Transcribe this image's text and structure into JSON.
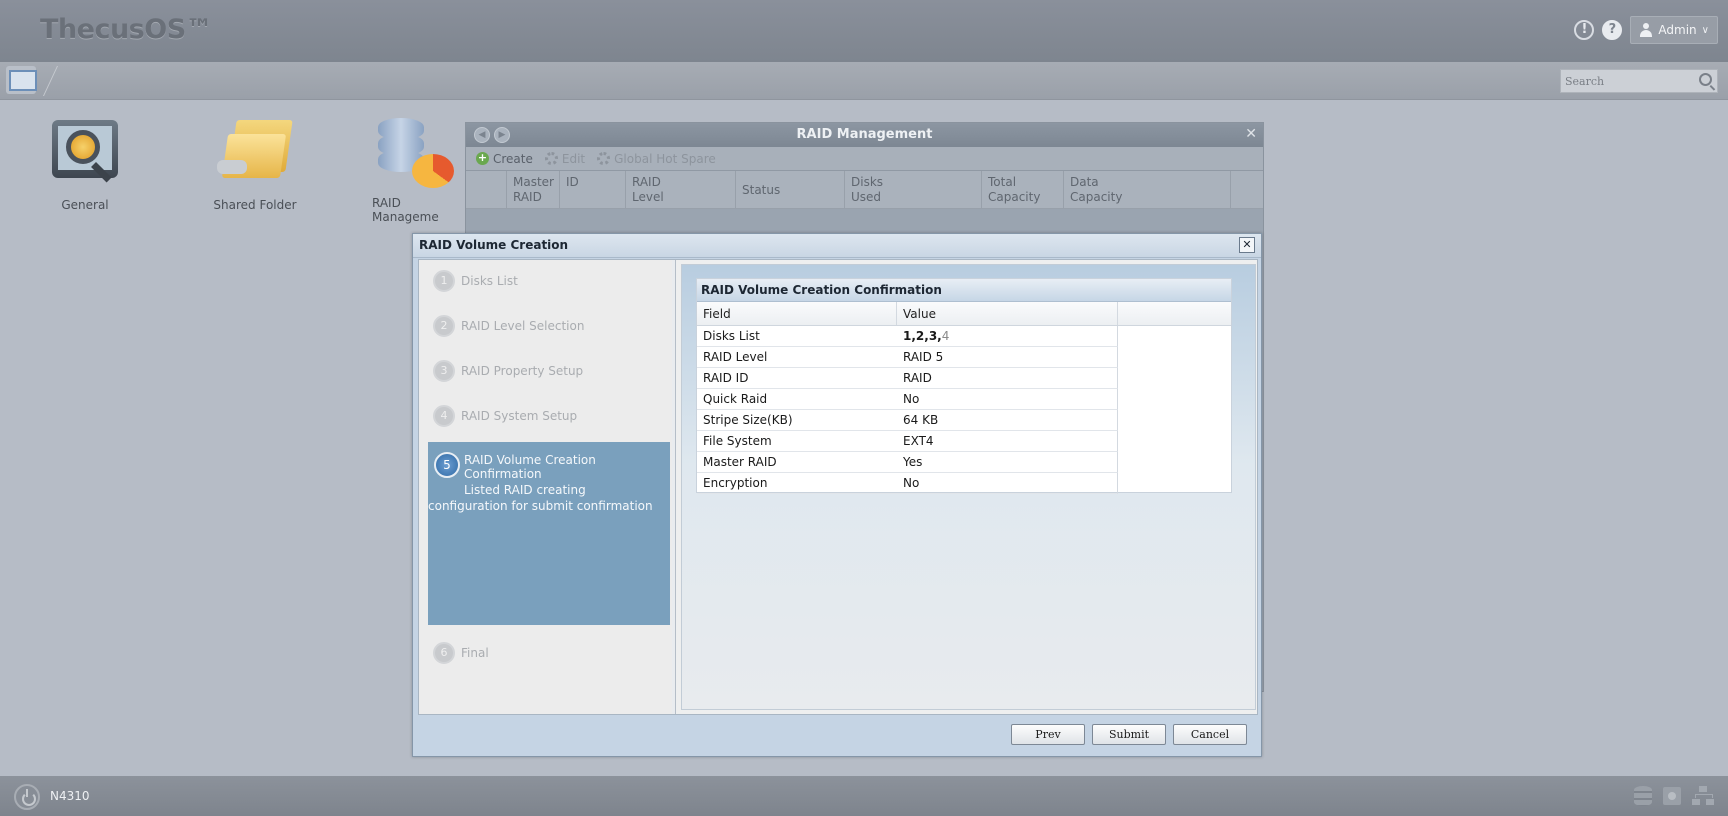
{
  "app": {
    "brand": "ThecusOS™"
  },
  "header": {
    "user_label": "Admin",
    "alert_icon": "!",
    "help_icon": "?"
  },
  "toolbar": {
    "search_placeholder": "Search"
  },
  "desktop": {
    "items": [
      {
        "label": "General",
        "icon": "general-settings-icon"
      },
      {
        "label": "Shared Folder",
        "icon": "shared-folder-icon"
      },
      {
        "label": "RAID Manageme",
        "icon": "raid-management-icon"
      }
    ]
  },
  "raid_window": {
    "title": "RAID Management",
    "tools": {
      "create": "Create",
      "edit": "Edit",
      "global_hot_spare": "Global Hot Spare"
    },
    "columns": [
      [
        "Master",
        "RAID"
      ],
      [
        "ID",
        ""
      ],
      [
        "RAID",
        "Level"
      ],
      [
        "Status",
        ""
      ],
      [
        "Disks",
        "Used"
      ],
      [
        "Total",
        "Capacity"
      ],
      [
        "Data",
        "Capacity"
      ]
    ]
  },
  "dialog": {
    "title": "RAID Volume Creation",
    "steps": [
      {
        "num": "1",
        "label": "Disks List"
      },
      {
        "num": "2",
        "label": "RAID Level Selection"
      },
      {
        "num": "3",
        "label": "RAID Property Setup"
      },
      {
        "num": "4",
        "label": "RAID System Setup"
      },
      {
        "num": "5",
        "label": "RAID Volume Creation Confirmation",
        "description": "Listed RAID creating configuration for submit confirmation"
      },
      {
        "num": "6",
        "label": "Final"
      }
    ],
    "active_step": 5,
    "confirmation": {
      "title": "RAID Volume Creation Confirmation",
      "headers": {
        "field": "Field",
        "value": "Value"
      },
      "rows": [
        {
          "field": "Disks List",
          "value": "1,2,3,4"
        },
        {
          "field": "RAID Level",
          "value": "RAID 5"
        },
        {
          "field": "RAID ID",
          "value": "RAID"
        },
        {
          "field": "Quick Raid",
          "value": "No"
        },
        {
          "field": "Stripe Size(KB)",
          "value": "64 KB"
        },
        {
          "field": "File System",
          "value": "EXT4"
        },
        {
          "field": "Master RAID",
          "value": "Yes"
        },
        {
          "field": "Encryption",
          "value": "No"
        }
      ],
      "disks_list_parts": {
        "strong": "1,2,3,",
        "last": "4"
      }
    },
    "buttons": {
      "prev": "Prev",
      "submit": "Submit",
      "cancel": "Cancel"
    }
  },
  "footer": {
    "device": "N4310"
  }
}
